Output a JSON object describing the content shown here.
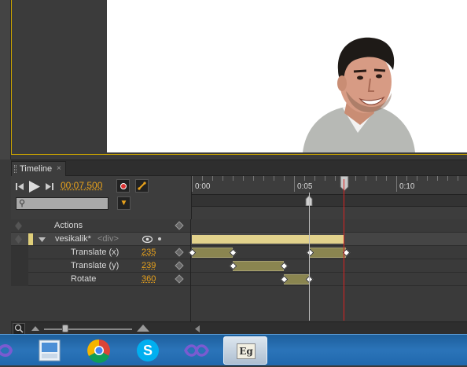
{
  "timeline": {
    "tab_label": "Timeline",
    "tab_close": "×",
    "time": "00:07.500",
    "ruler": [
      "0:00",
      "0:05",
      "0:10"
    ],
    "actions_label": "Actions",
    "element_name": "vesikalik*",
    "element_tag": "<div>",
    "properties": [
      {
        "label": "Translate (x)",
        "value": "235"
      },
      {
        "label": "Translate (y)",
        "value": "239"
      },
      {
        "label": "Rotate",
        "value": "360"
      }
    ]
  },
  "taskbar": {
    "apps": [
      "vs-icon",
      "file-manager-icon",
      "chrome-icon",
      "skype-icon",
      "vs-icon",
      "edge-animate-icon"
    ],
    "active_app_label": "Eg"
  },
  "colors": {
    "accent": "#e8a21c",
    "playhead": "#dd2222",
    "track": "#8a8550"
  }
}
